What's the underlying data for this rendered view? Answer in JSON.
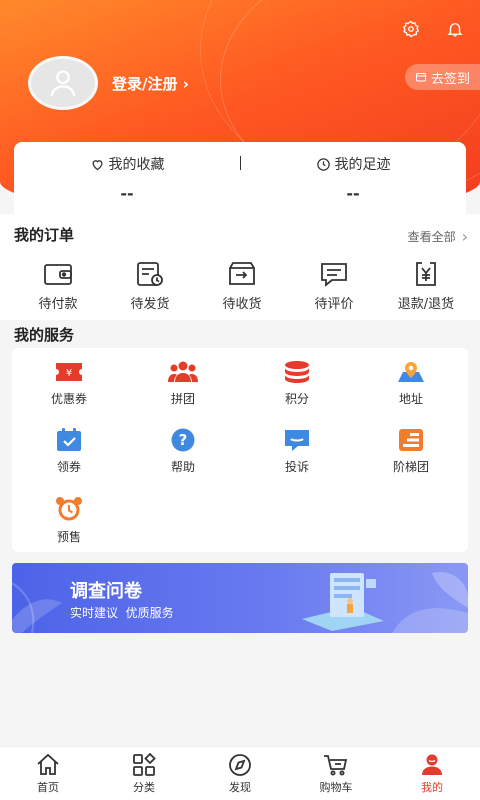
{
  "header": {
    "login_label": "登录/注册",
    "checkin_label": "去签到",
    "settings_icon": "gear-icon",
    "message_icon": "bell-icon"
  },
  "stats": {
    "favorites_label": "我的收藏",
    "favorites_value": "--",
    "footprint_label": "我的足迹",
    "footprint_value": "--"
  },
  "orders": {
    "title": "我的订单",
    "view_all": "查看全部",
    "items": [
      {
        "label": "待付款",
        "icon": "wallet-icon"
      },
      {
        "label": "待发货",
        "icon": "pending-ship-icon"
      },
      {
        "label": "待收货",
        "icon": "truck-box-icon"
      },
      {
        "label": "待评价",
        "icon": "comment-icon"
      },
      {
        "label": "退款/退货",
        "icon": "refund-icon"
      }
    ]
  },
  "services": {
    "title": "我的服务",
    "items": [
      {
        "label": "优惠券",
        "icon": "coupon-icon",
        "color": "#e53b2a"
      },
      {
        "label": "拼团",
        "icon": "group-icon",
        "color": "#e53b2a"
      },
      {
        "label": "积分",
        "icon": "points-icon",
        "color": "#e53b2a"
      },
      {
        "label": "地址",
        "icon": "location-icon",
        "color": "#3f8ae0"
      },
      {
        "label": "领券",
        "icon": "get-coupon-icon",
        "color": "#3f8ae0"
      },
      {
        "label": "帮助",
        "icon": "help-icon",
        "color": "#3f8ae0"
      },
      {
        "label": "投诉",
        "icon": "complaint-icon",
        "color": "#3f8ae0"
      },
      {
        "label": "阶梯团",
        "icon": "ladder-group-icon",
        "color": "#f07c2c"
      },
      {
        "label": "预售",
        "icon": "presale-icon",
        "color": "#f07c2c"
      }
    ]
  },
  "banner": {
    "title": "调查问卷",
    "subtitle": "实时建议  优质服务"
  },
  "tabbar": {
    "items": [
      {
        "label": "首页",
        "icon": "home-icon"
      },
      {
        "label": "分类",
        "icon": "category-icon"
      },
      {
        "label": "发现",
        "icon": "compass-icon"
      },
      {
        "label": "购物车",
        "icon": "cart-icon"
      },
      {
        "label": "我的",
        "icon": "user-icon",
        "active": true
      }
    ]
  },
  "colors": {
    "brand": "#f23b1f",
    "accent_blue": "#4d63e8"
  }
}
